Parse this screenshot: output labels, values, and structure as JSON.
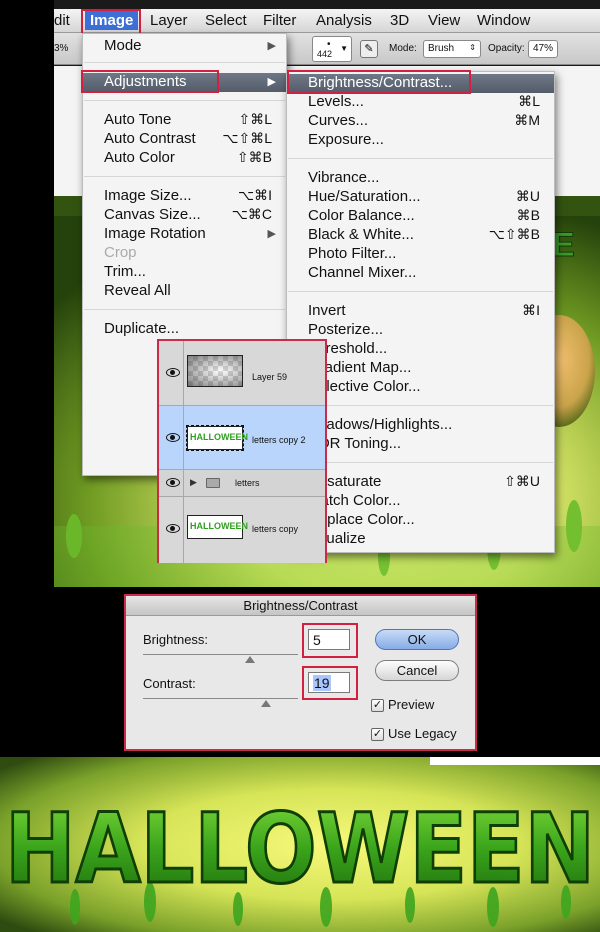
{
  "menubar": {
    "items": [
      "dit",
      "Image",
      "Layer",
      "Select",
      "Filter",
      "Analysis",
      "3D",
      "View",
      "Window"
    ]
  },
  "options_bar": {
    "zoom_fragment": "3%",
    "brush_size": "442",
    "mode_label": "Mode:",
    "mode_value": "Brush",
    "opacity_label": "Opacity:",
    "opacity_value": "47%"
  },
  "image_menu": {
    "items": [
      {
        "label": "Mode",
        "shortcut": "",
        "submenu": true
      },
      {
        "label": "Adjustments",
        "shortcut": "",
        "submenu": true,
        "highlighted": true
      },
      {
        "label": "Auto Tone",
        "shortcut": "⇧⌘L"
      },
      {
        "label": "Auto Contrast",
        "shortcut": "⌥⇧⌘L"
      },
      {
        "label": "Auto Color",
        "shortcut": "⇧⌘B"
      },
      {
        "label": "Image Size...",
        "shortcut": "⌥⌘I"
      },
      {
        "label": "Canvas Size...",
        "shortcut": "⌥⌘C"
      },
      {
        "label": "Image Rotation",
        "shortcut": "",
        "submenu": true
      },
      {
        "label": "Crop",
        "shortcut": "",
        "disabled": true
      },
      {
        "label": "Trim...",
        "shortcut": ""
      },
      {
        "label": "Reveal All",
        "shortcut": ""
      },
      {
        "label": "Duplicate...",
        "shortcut": ""
      }
    ]
  },
  "adjustments_menu": {
    "items": [
      {
        "label": "Brightness/Contrast...",
        "shortcut": "",
        "highlighted": true
      },
      {
        "label": "Levels...",
        "shortcut": "⌘L"
      },
      {
        "label": "Curves...",
        "shortcut": "⌘M"
      },
      {
        "label": "Exposure...",
        "shortcut": ""
      },
      {
        "label": "Vibrance...",
        "shortcut": ""
      },
      {
        "label": "Hue/Saturation...",
        "shortcut": "⌘U"
      },
      {
        "label": "Color Balance...",
        "shortcut": "⌘B"
      },
      {
        "label": "Black & White...",
        "shortcut": "⌥⇧⌘B"
      },
      {
        "label": "Photo Filter...",
        "shortcut": ""
      },
      {
        "label": "Channel Mixer...",
        "shortcut": ""
      },
      {
        "label": "Invert",
        "shortcut": "⌘I"
      },
      {
        "label": "Posterize...",
        "shortcut": ""
      },
      {
        "label": "Threshold...",
        "shortcut": ""
      },
      {
        "label": "Gradient Map...",
        "shortcut": ""
      },
      {
        "label": "Selective Color...",
        "shortcut": ""
      },
      {
        "label": "Shadows/Highlights...",
        "shortcut": ""
      },
      {
        "label": "HDR Toning...",
        "shortcut": ""
      },
      {
        "label": "Desaturate",
        "shortcut": "⇧⌘U"
      },
      {
        "label": "Match Color...",
        "shortcut": ""
      },
      {
        "label": "Replace Color...",
        "shortcut": ""
      },
      {
        "label": "Equalize",
        "shortcut": ""
      }
    ]
  },
  "layers": [
    {
      "name": "Layer 59",
      "thumb_text": ""
    },
    {
      "name": "letters copy 2",
      "thumb_text": "HALLOWEEN",
      "selected": true
    },
    {
      "name": "letters",
      "thumb_text": "",
      "group": true
    },
    {
      "name": "letters copy",
      "thumb_text": "HALLOWEEN"
    }
  ],
  "dialog": {
    "title": "Brightness/Contrast",
    "brightness_label": "Brightness:",
    "brightness_value": "5",
    "contrast_label": "Contrast:",
    "contrast_value": "19",
    "ok_label": "OK",
    "cancel_label": "Cancel",
    "preview_label": "Preview",
    "preview_checked": true,
    "legacy_label": "Use Legacy",
    "legacy_checked": true
  },
  "artwork": {
    "corner_text": "WE",
    "banner_text": "HALLOWEEN"
  },
  "colors": {
    "highlight_box": "#d42040",
    "menu_highlight": "#5b6371",
    "slime_green": "#3fae1e",
    "glow_yellow": "#f3f56a"
  }
}
